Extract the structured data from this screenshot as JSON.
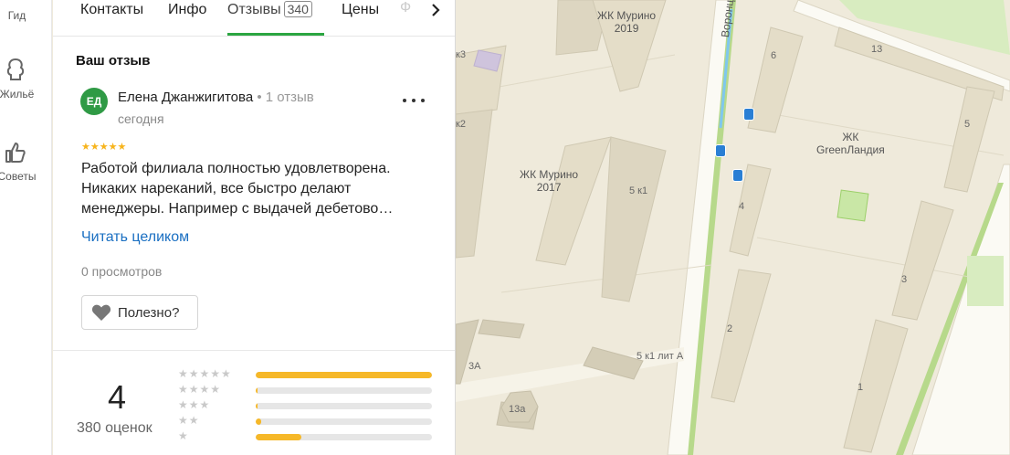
{
  "leftnav": {
    "items": [
      {
        "label": "Гид",
        "icon": "guide-icon"
      },
      {
        "label": "Жильё",
        "icon": "housing-icon"
      },
      {
        "label": "Советы",
        "icon": "thumbs-up-icon"
      }
    ]
  },
  "tabs": [
    {
      "label": "Контакты"
    },
    {
      "label": "Инфо"
    },
    {
      "label": "Отзывы",
      "count": "340",
      "active": true
    },
    {
      "label": "Цены"
    },
    {
      "label": "Ф"
    }
  ],
  "review": {
    "section_title": "Ваш отзыв",
    "avatar_initials": "ЕД",
    "avatar_color": "#2f9a45",
    "author": "Елена Джанжигитова",
    "author_meta": " • 1 отзыв",
    "date": "сегодня",
    "stars": "★★★★★",
    "text": "Работой филиала полностью удовлетворена. Никаких нареканий, все быстро делают менеджеры. Например с выдачей дебетово…",
    "read_more": "Читать целиком",
    "views": "0 просмотров",
    "useful_label": "Полезно?"
  },
  "rating": {
    "value": "4",
    "count_label": "380 оценок",
    "histogram": [
      {
        "stars": "★★★★★",
        "fraction": 1.0
      },
      {
        "stars": "★★★★",
        "fraction": 0.01
      },
      {
        "stars": "★★★",
        "fraction": 0.01
      },
      {
        "stars": "★★",
        "fraction": 0.03
      },
      {
        "stars": "★",
        "fraction": 0.26
      }
    ]
  },
  "map": {
    "labels": [
      {
        "text": "ЖК Мурино\n2019"
      },
      {
        "text": "ЖК Мурино\n2017"
      },
      {
        "text": "ЖК\nGreenЛандия"
      },
      {
        "text": "Воронцо"
      }
    ],
    "house_numbers": [
      "5 к1",
      "6",
      "13",
      "5",
      "4",
      "3",
      "2",
      "1",
      "5 к1 лит А",
      "3А",
      "13а",
      "к2",
      "к3"
    ]
  },
  "colors": {
    "accent_green": "#2ba641",
    "link_blue": "#1a6fc2",
    "star_yellow": "#f6b828"
  }
}
